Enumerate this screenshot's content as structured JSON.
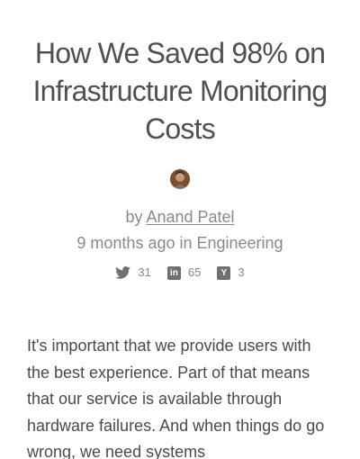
{
  "article": {
    "title": "How We Saved 98% on Infrastructure Monitoring Costs",
    "byline_prefix": "by",
    "author": "Anand Patel",
    "meta": "9 months ago in Engineering",
    "body": "It's important that we provide users with the best experience. Part of that means that our service is available through hardware failures. And when things do go wrong, we need systems"
  },
  "shares": [
    {
      "network": "twitter",
      "icon": "twitter-icon",
      "count": "31"
    },
    {
      "network": "linkedin",
      "icon": "linkedin-icon",
      "label": "in",
      "count": "65"
    },
    {
      "network": "hackernews",
      "icon": "hacker-news-icon",
      "label": "Y",
      "count": "3"
    }
  ],
  "colors": {
    "title": "#505050",
    "muted": "#8a8a8a",
    "body": "#4a4a4a",
    "icon": "#707070"
  }
}
